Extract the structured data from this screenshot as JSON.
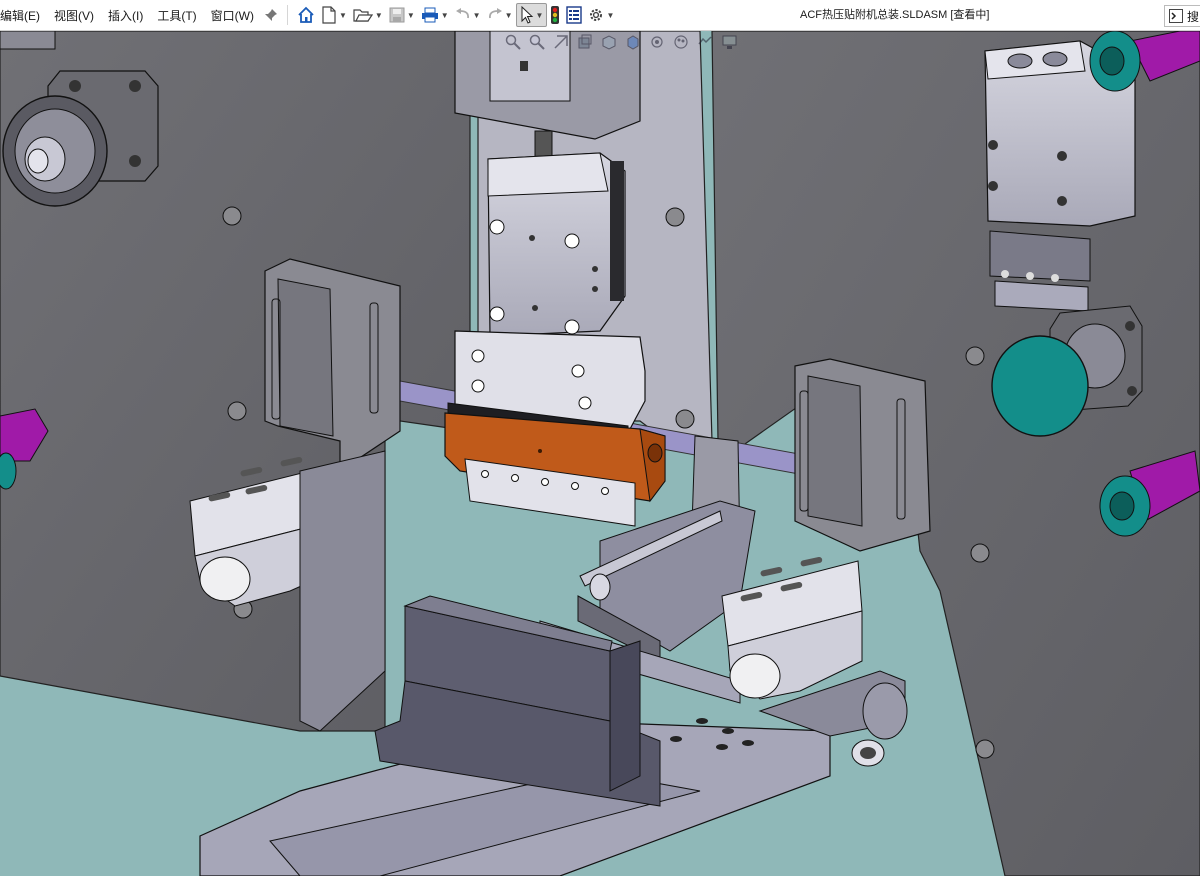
{
  "menu": {
    "items": [
      "编辑(E)",
      "视图(V)",
      "插入(I)",
      "工具(T)",
      "窗口(W)"
    ]
  },
  "toolbar": {
    "icons": [
      "pin-icon",
      "home-icon",
      "new-document-icon",
      "open-folder-icon",
      "save-icon",
      "print-icon",
      "undo-icon",
      "redo-icon",
      "select-pointer-icon",
      "rebuild-traffic-light-icon",
      "file-properties-icon",
      "options-gear-icon"
    ]
  },
  "document": {
    "title": "ACF热压贴附机总装.SLDASM [查看中]"
  },
  "search": {
    "label": "搜"
  },
  "colors": {
    "floor": "#8fb8b8",
    "plate": "#6b6b6f",
    "steel": "#b8b8c8",
    "copper": "#c05a1a",
    "teal": "#138e8a",
    "magenta": "#a01aa8"
  }
}
